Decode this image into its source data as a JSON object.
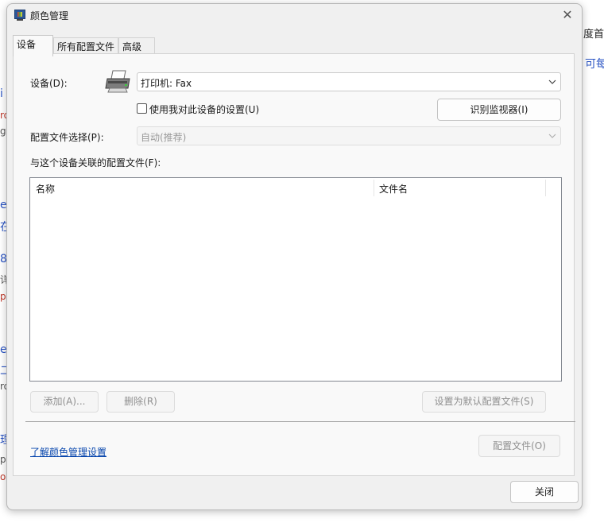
{
  "background": {
    "fragments": [
      "度首",
      "i",
      "ro",
      "go",
      "e",
      "在",
      "8",
      "详",
      "p",
      "ey",
      "二",
      "ro",
      "理",
      "p",
      "or",
      "可每"
    ]
  },
  "window": {
    "title": "颜色管理",
    "close_glyph": "✕",
    "icon": "color-management-monitor-icon"
  },
  "tabs": [
    {
      "label": "设备",
      "active": true
    },
    {
      "label": "所有配置文件",
      "active": false
    },
    {
      "label": "高级",
      "active": false
    }
  ],
  "device": {
    "label": "设备(D):",
    "label_mnemonic": "D",
    "selected": "打印机: Fax",
    "device_icon": "printer-icon",
    "use_my_settings": {
      "label": "使用我对此设备的设置(U)",
      "checked": false
    },
    "identify_button": "识别监视器(I)"
  },
  "profile_selection": {
    "label": "配置文件选择(P):",
    "value": "自动(推荐)",
    "enabled": false
  },
  "associated_profiles": {
    "label": "与这个设备关联的配置文件(F):",
    "columns": [
      "名称",
      "文件名"
    ],
    "rows": []
  },
  "actions": {
    "add": "添加(A)...",
    "remove": "删除(R)",
    "set_default": "设置为默认配置文件(S)"
  },
  "footer": {
    "learn_link": "了解颜色管理设置",
    "profiles_button": "配置文件(O)",
    "close_button": "关闭"
  }
}
